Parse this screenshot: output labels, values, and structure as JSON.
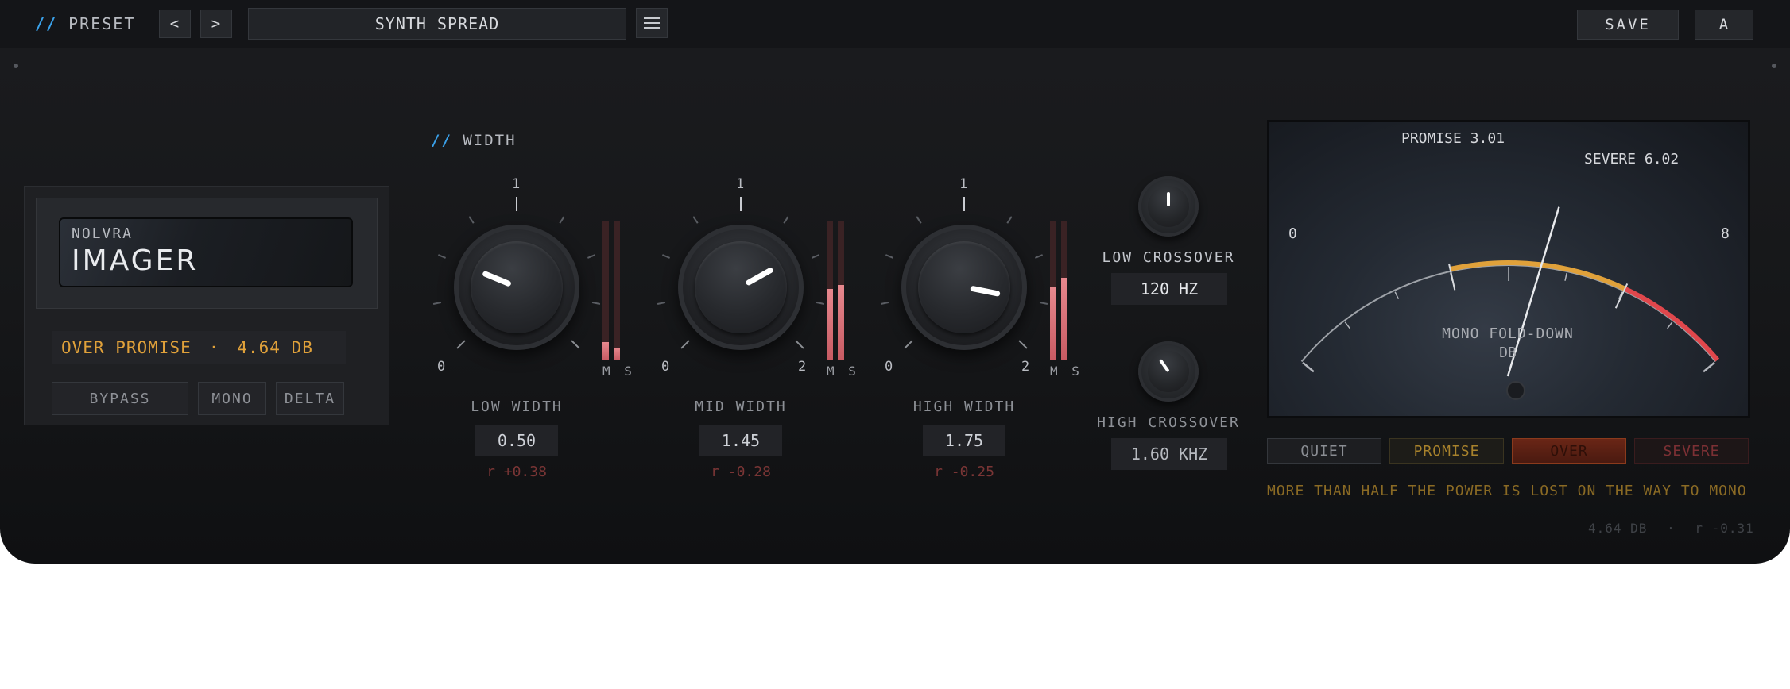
{
  "topbar": {
    "preset_label": "PRESET",
    "prev_label": "<",
    "next_label": ">",
    "preset_name": "SYNTH SPREAD",
    "save_label": "SAVE",
    "ab_label": "A"
  },
  "brand": {
    "company": "NOLVRA",
    "product": "IMAGER"
  },
  "status": {
    "zone": "OVER PROMISE",
    "separator": "·",
    "value": "4.64 DB"
  },
  "controls": {
    "bypass": "BYPASS",
    "mono": "MONO",
    "delta": "DELTA"
  },
  "width_section": {
    "title": "WIDTH",
    "scale_min": "0",
    "scale_mid": "1",
    "scale_max": "2",
    "ms_label": "M S",
    "knobs": [
      {
        "name": "LOW WIDTH",
        "value": "0.50",
        "value_num": 0.5,
        "corr": "r +0.38",
        "meter_m": 0.13,
        "meter_s": 0.09
      },
      {
        "name": "MID WIDTH",
        "value": "1.45",
        "value_num": 1.45,
        "corr": "r -0.28",
        "meter_m": 0.51,
        "meter_s": 0.54
      },
      {
        "name": "HIGH WIDTH",
        "value": "1.75",
        "value_num": 1.75,
        "corr": "r -0.25",
        "meter_m": 0.53,
        "meter_s": 0.59
      }
    ]
  },
  "crossover": {
    "low_label": "LOW CROSSOVER",
    "low_value": "120 HZ",
    "high_label": "HIGH CROSSOVER",
    "high_value": "1.60 KHZ"
  },
  "meter": {
    "min_label": "0",
    "max_label": "8",
    "promise_label": "PROMISE 3.01",
    "severe_label": "SEVERE 6.02",
    "caption_line1": "MONO FOLD-DOWN",
    "caption_line2": "DB",
    "reading_db": 4.64,
    "promise_db": 3.01,
    "severe_db": 6.02,
    "range_max": 8,
    "colors": {
      "promise": "#e0a13a",
      "severe": "#e0474c",
      "scale": "#9ea2a8"
    }
  },
  "zones": {
    "quiet": "QUIET",
    "promise": "PROMISE",
    "over": "OVER",
    "severe": "SEVERE",
    "active": "over"
  },
  "message": "MORE THAN HALF THE POWER IS LOST ON THE WAY TO MONO",
  "footer": {
    "db": "4.64 DB",
    "sep": "·",
    "corr": "r -0.31"
  }
}
